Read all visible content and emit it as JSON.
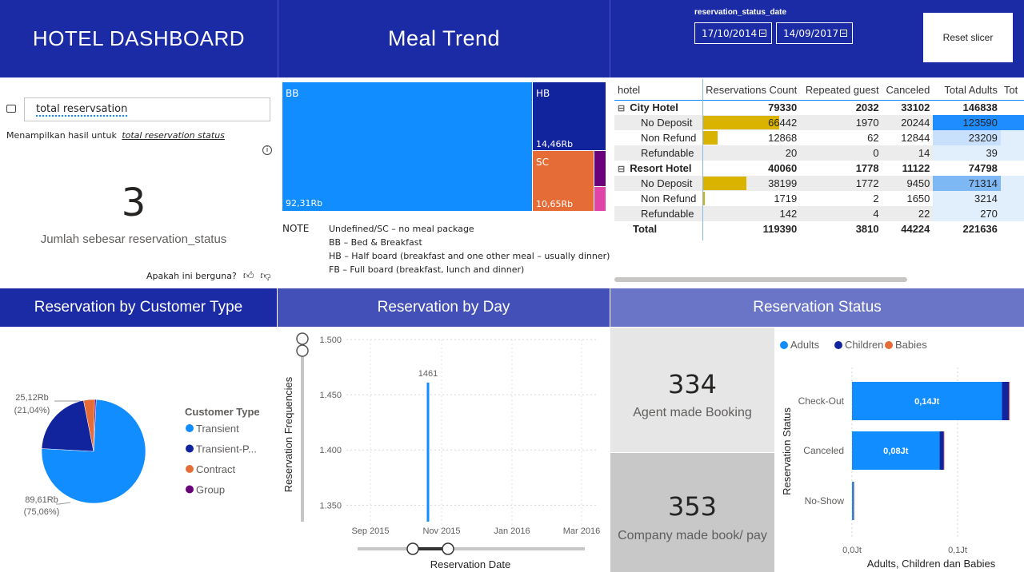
{
  "header": {
    "title": "HOTEL DASHBOARD",
    "meal_title": "Meal Trend",
    "slicer_label": "reservation_status_date",
    "date_from": "17/10/2014",
    "date_to": "14/09/2017",
    "reset_label": "Reset slicer"
  },
  "qa": {
    "query": "total reservsation",
    "result_prefix": "Menampilkan hasil untuk",
    "result_link": "total reservation status",
    "value": "3",
    "value_label": "Jumlah sebesar reservation_status",
    "feedback": "Apakah ini berguna?"
  },
  "treemap": {
    "bb_label": "BB",
    "bb_value": "92,31Rb",
    "hb_label": "HB",
    "hb_value": "14,46Rb",
    "sc_label": "SC",
    "sc_value": "10,65Rb"
  },
  "note": {
    "title": "NOTE",
    "lines": [
      "Undefined/SC – no meal package",
      "BB – Bed & Breakfast",
      "HB – Half board (breakfast and one other meal – usually dinner)",
      "FB – Full board (breakfast, lunch and dinner)"
    ]
  },
  "matrix": {
    "headers": [
      "hotel",
      "Reservations Count",
      "Repeated guest",
      "Canceled",
      "Total Adults",
      "Tot"
    ],
    "rows": [
      {
        "label": "City Hotel",
        "level": 0,
        "vals": [
          "79330",
          "2032",
          "33102",
          "146838"
        ]
      },
      {
        "label": "No Deposit",
        "level": 1,
        "vals": [
          "66442",
          "1970",
          "20244",
          "123590"
        ]
      },
      {
        "label": "Non Refund",
        "level": 1,
        "vals": [
          "12868",
          "62",
          "12844",
          "23209"
        ]
      },
      {
        "label": "Refundable",
        "level": 1,
        "vals": [
          "20",
          "0",
          "14",
          "39"
        ]
      },
      {
        "label": "Resort Hotel",
        "level": 0,
        "vals": [
          "40060",
          "1778",
          "11122",
          "74798"
        ]
      },
      {
        "label": "No Deposit",
        "level": 1,
        "vals": [
          "38199",
          "1772",
          "9450",
          "71314"
        ]
      },
      {
        "label": "Non Refund",
        "level": 1,
        "vals": [
          "1719",
          "2",
          "1650",
          "3214"
        ]
      },
      {
        "label": "Refundable",
        "level": 1,
        "vals": [
          "142",
          "4",
          "22",
          "270"
        ]
      },
      {
        "label": "Total",
        "level": 2,
        "vals": [
          "119390",
          "3810",
          "44224",
          "221636"
        ]
      }
    ],
    "collapse_symbol": "⊟"
  },
  "sections": {
    "customer_type": "Reservation by Customer Type",
    "by_day": "Reservation by Day",
    "status": "Reservation Status"
  },
  "kpis": {
    "agent_value": "334",
    "agent_label": "Agent made Booking",
    "company_value": "353",
    "company_label": "Company made book/ pay"
  },
  "colors": {
    "header_bg": "#1b2ba6",
    "bb": "#118dff",
    "hb": "#12239e",
    "sc": "#e66c37",
    "fb": "#6b007b",
    "other": "#e044a7",
    "gold": "#d9b300"
  },
  "chart_data": [
    {
      "type": "pie",
      "legend_title": "Customer Type",
      "slices": [
        {
          "name": "Transient",
          "value": 89610,
          "label": "89,61Rb",
          "pct": "(75,06%)",
          "color": "#118dff"
        },
        {
          "name": "Transient-P...",
          "value": 25120,
          "label": "25,12Rb",
          "pct": "(21,04%)",
          "color": "#12239e"
        },
        {
          "name": "Contract",
          "value": 4076,
          "label": "",
          "pct": "",
          "color": "#e66c37"
        },
        {
          "name": "Group",
          "value": 577,
          "label": "",
          "pct": "",
          "color": "#6b007b"
        }
      ]
    },
    {
      "type": "line",
      "xlabel": "Reservation Date",
      "ylabel": "Reservation Frequencies",
      "ylim": [
        1330,
        1500
      ],
      "y_ticks": [
        "1.500",
        "1.450",
        "1.400",
        "1.350"
      ],
      "y_tick_values": [
        1500,
        1450,
        1400,
        1350
      ],
      "x_ticks": [
        "Sep 2015",
        "Nov 2015",
        "Jan 2016",
        "Mar 2016"
      ],
      "spike_label": "1461",
      "spike_value": 1461,
      "spike_date": "Oct 2015"
    },
    {
      "type": "bar",
      "orientation": "horizontal",
      "stacked": true,
      "ylabel": "Reservation Status",
      "xlabel": "Adults, Children dan Babies",
      "categories": [
        "Check-Out",
        "Canceled",
        "No-Show"
      ],
      "series": [
        {
          "name": "Adults",
          "color": "#118dff",
          "values": [
            142000,
            83000,
            1500
          ]
        },
        {
          "name": "Children",
          "color": "#12239e",
          "values": [
            6700,
            4000,
            100
          ]
        },
        {
          "name": "Babies",
          "color": "#e66c37",
          "values": [
            700,
            150,
            10
          ]
        }
      ],
      "bar_labels": [
        "0,14Jt",
        "0,08Jt",
        ""
      ],
      "x_ticks": [
        "0,0Jt",
        "0,1Jt"
      ],
      "xlim": [
        0,
        150000
      ]
    }
  ]
}
